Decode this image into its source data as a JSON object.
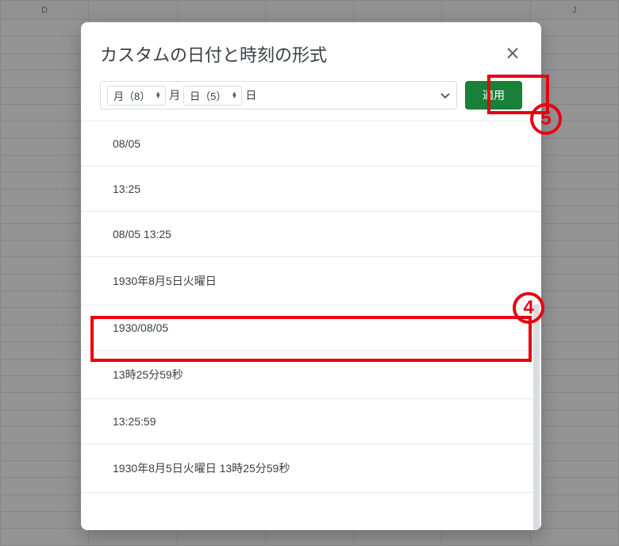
{
  "sheet": {
    "columns": [
      "D",
      "",
      "",
      "",
      "",
      "",
      "J"
    ]
  },
  "dialog": {
    "title": "カスタムの日付と時刻の形式",
    "apply_label": "適用",
    "tokens": [
      {
        "label": "月（8）"
      },
      {
        "label": "日（5）"
      }
    ],
    "separators": [
      "月",
      "日"
    ],
    "options": [
      "08/05",
      "13:25",
      "08/05 13:25",
      "1930年8月5日火曜日",
      "1930/08/05",
      "13時25分59秒",
      "13:25:59",
      "1930年8月5日火曜日 13時25分59秒"
    ]
  },
  "annotations": {
    "four": "4",
    "five": "5"
  }
}
